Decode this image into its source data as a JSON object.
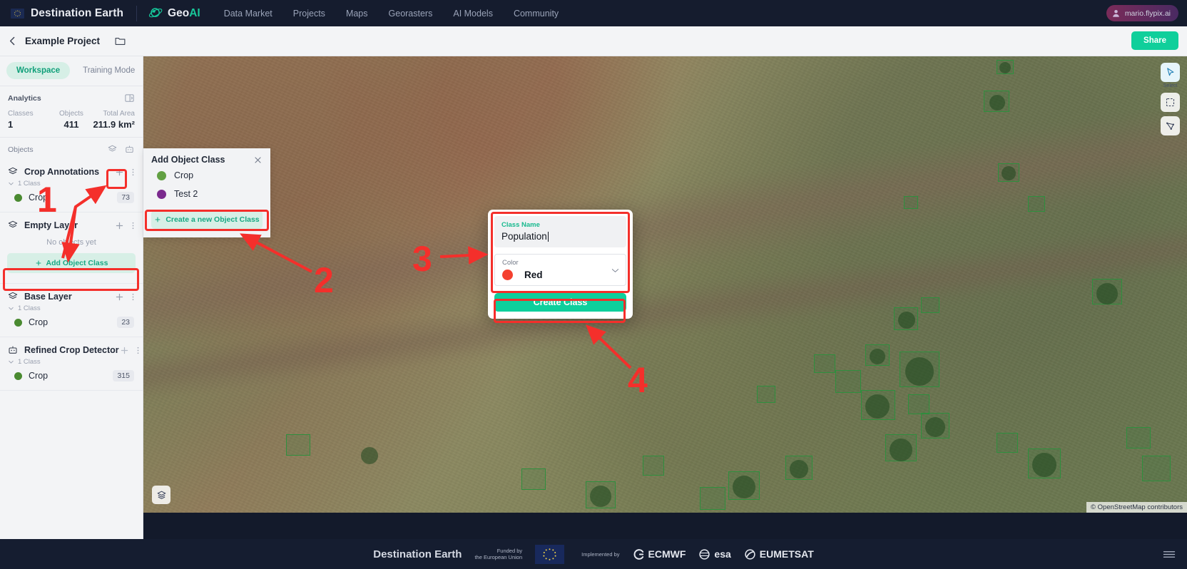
{
  "topnav": {
    "brand": "Destination Earth",
    "product": "Geo",
    "product_accent": "AI",
    "links": [
      "Data Market",
      "Projects",
      "Maps",
      "Georasters",
      "AI Models",
      "Community"
    ],
    "user": "mario.flypix.ai"
  },
  "projectbar": {
    "project_name": "Example Project",
    "share_label": "Share"
  },
  "sidebar": {
    "tabs": [
      {
        "label": "Workspace",
        "active": true
      },
      {
        "label": "Training Mode",
        "active": false
      }
    ],
    "analytics": {
      "title": "Analytics",
      "stats": [
        {
          "key": "Classes",
          "value": "1"
        },
        {
          "key": "Objects",
          "value": "411"
        },
        {
          "key": "Total Area",
          "value": "211.9 km²"
        }
      ]
    },
    "objects_title": "Objects",
    "layers": [
      {
        "name": "Crop Annotations",
        "icon": "layers-icon",
        "sub": "1 Class",
        "classes": [
          {
            "name": "Crop",
            "count": "73",
            "color": "#4a8a31"
          }
        ],
        "empty_text": null,
        "add_button": null
      },
      {
        "name": "Empty Layer",
        "icon": "layers-icon",
        "sub": null,
        "classes": [],
        "empty_text": "No objects yet",
        "add_button": "Add Object Class"
      },
      {
        "name": "Base Layer",
        "icon": "layers-icon",
        "sub": "1 Class",
        "classes": [
          {
            "name": "Crop",
            "count": "23",
            "color": "#4a8a31"
          }
        ],
        "empty_text": null,
        "add_button": null
      },
      {
        "name": "Refined Crop Detector",
        "icon": "robot-icon",
        "sub": "1 Class",
        "classes": [
          {
            "name": "Crop",
            "count": "315",
            "color": "#4a8a31"
          }
        ],
        "empty_text": null,
        "add_button": null
      }
    ]
  },
  "add_object_class_panel": {
    "title": "Add Object Class",
    "items": [
      {
        "name": "Crop",
        "color": "#62a043"
      },
      {
        "name": "Test 2",
        "color": "#7b2a8e"
      }
    ],
    "create_label": "Create a new Object Class"
  },
  "modal": {
    "class_name_label": "Class Name",
    "class_name_value": "Population",
    "color_label": "Color",
    "color_value": "Red",
    "color_hex": "#f4402f",
    "submit_label": "Create Class"
  },
  "map": {
    "attribution": "© OpenStreetMap contributors",
    "tools": [
      {
        "name": "select-tool",
        "label": "Select"
      },
      {
        "name": "box-tool",
        "label": ""
      },
      {
        "name": "polygon-tool",
        "label": ""
      }
    ]
  },
  "annotations": {
    "accent": "#f42f2b",
    "numbers": [
      "1",
      "2",
      "3",
      "4"
    ]
  },
  "footer": {
    "title": "Destination Earth",
    "funded_line1": "Funded by",
    "funded_line2": "the European Union",
    "implemented_by": "Implemented by",
    "orgs": [
      "ECMWF",
      "esa",
      "EUMETSAT"
    ]
  }
}
